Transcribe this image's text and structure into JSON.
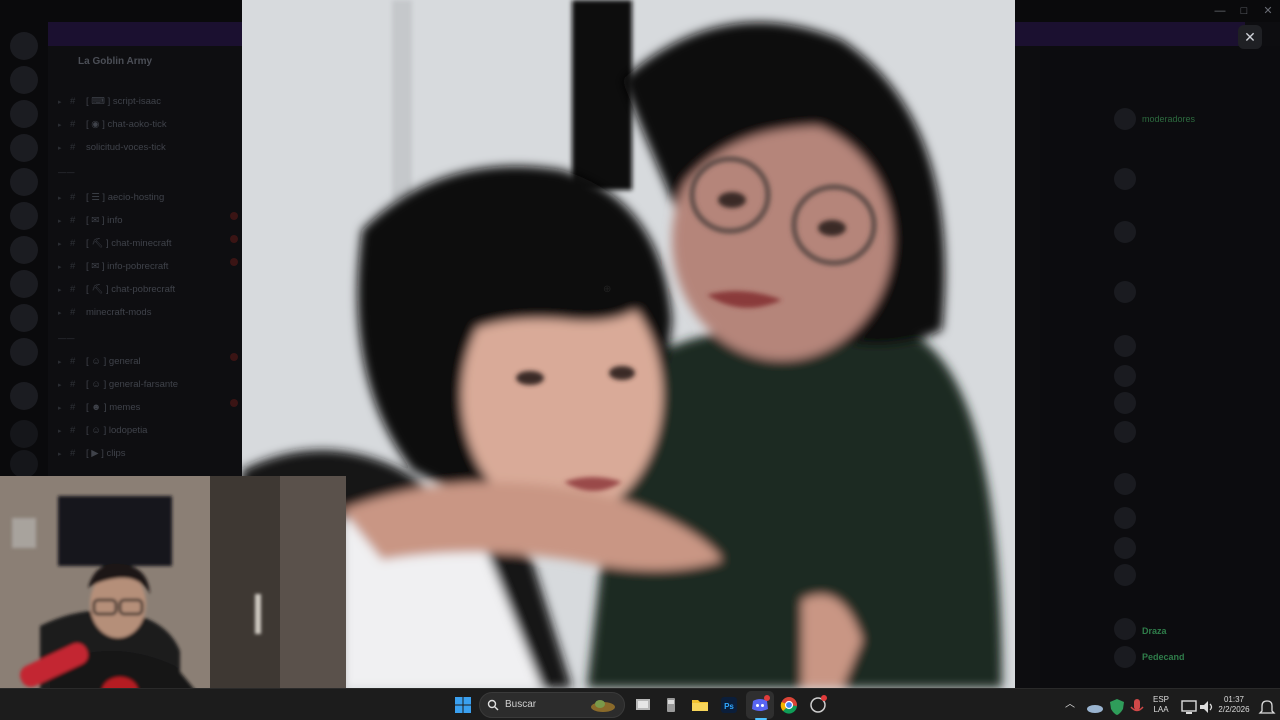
{
  "discord": {
    "server_name": "La Goblin Army",
    "channels": [
      {
        "label": "script-isaac",
        "prefix": "[ ⌨ ]"
      },
      {
        "label": "chat-aoko-tick",
        "prefix": "[ ◉ ]"
      },
      {
        "label": "solicitud-voces-tick",
        "prefix": ""
      },
      {
        "label": "aecio-hosting",
        "prefix": "[ ☰ ]"
      },
      {
        "label": "info",
        "prefix": "[ ✉ ]"
      },
      {
        "label": "chat-minecraft",
        "prefix": "[ ⛏ ]"
      },
      {
        "label": "info-pobrecraft",
        "prefix": "[ ✉ ]"
      },
      {
        "label": "chat-pobrecraft",
        "prefix": "[ ⛏ ]"
      },
      {
        "label": "minecraft-mods",
        "prefix": ""
      },
      {
        "label": "general",
        "prefix": "[ ☺ ]"
      },
      {
        "label": "general-farsante",
        "prefix": "[ ☺ ]"
      },
      {
        "label": "memes",
        "prefix": "[ ☻ ]"
      },
      {
        "label": "lodopetia",
        "prefix": "[ ☺ ]"
      },
      {
        "label": "clips",
        "prefix": "[ ▶ ]"
      }
    ],
    "members": [
      "moderadores",
      "",
      "",
      "",
      "",
      "",
      "",
      "",
      "",
      "",
      "",
      "",
      "",
      "",
      "",
      "",
      "Draza",
      "Pedecand"
    ]
  },
  "viewer": {
    "close_icon": "close-icon",
    "close_label": "✕"
  },
  "taskbar": {
    "search_placeholder": "Buscar",
    "lang_top": "ESP",
    "lang_bottom": "LAA",
    "time": "01:37",
    "date": "2/2/2026"
  }
}
